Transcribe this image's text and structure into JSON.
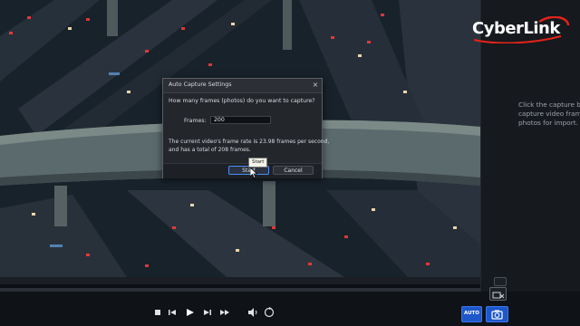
{
  "app": {
    "brand": "CyberLink"
  },
  "video": {
    "description_icon": "aerial-highway-night-photo"
  },
  "side_panel": {
    "help_lines": [
      "Click the capture butto",
      "capture video frames a",
      "photos for import."
    ]
  },
  "dialog": {
    "title": "Auto Capture Settings",
    "close_glyph": "×",
    "question": "How many frames (photos) do you want to capture?",
    "frames_label": "Frames:",
    "frames_value": "200",
    "info_line1": "The current video's frame rate is 23.98 frames per second,",
    "info_line2": "and has a total of 208 frames.",
    "start_label": "Start",
    "cancel_label": "Cancel",
    "tooltip": "Start"
  },
  "controls": {
    "auto_label": "AUTO",
    "icons": [
      "stop-icon",
      "previous-frame-icon",
      "play-icon",
      "next-frame-icon",
      "fast-forward-icon",
      "volume-icon",
      "repeat-icon",
      "camera-icon"
    ]
  },
  "colors": {
    "accent_blue": "#1e57c9",
    "brand_red": "#e2231a",
    "dialog_bg": "#23262b"
  }
}
